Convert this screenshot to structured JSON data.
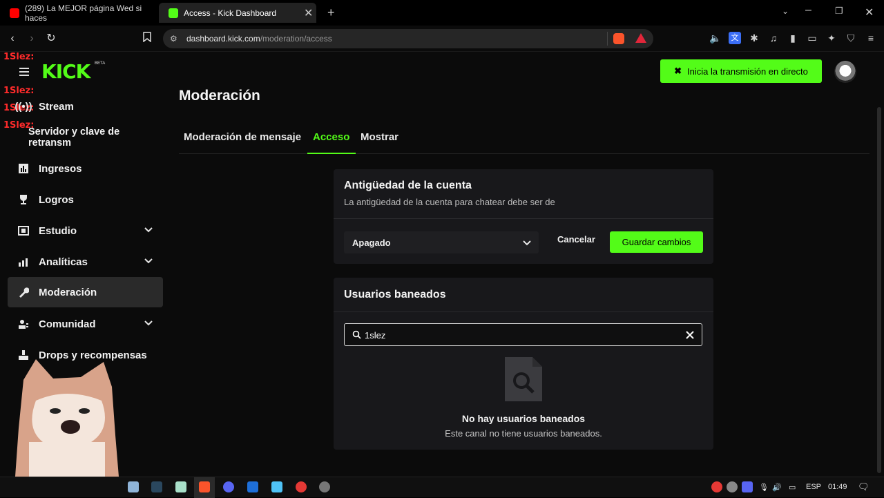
{
  "browser": {
    "tabs": [
      {
        "title": "(289) La MEJOR página Wed si haces",
        "favicon_color": "#ff0000"
      },
      {
        "title": "Access - Kick Dashboard",
        "favicon_color": "#53fc18"
      }
    ],
    "url_host": "dashboard.kick.com",
    "url_path": "/moderation/access"
  },
  "overlay": {
    "name": "1Slez:",
    "logo_text": "KICK",
    "logo_badge": "BETA"
  },
  "sidebar": {
    "items": [
      {
        "label": "Stream",
        "icon": "broadcast-icon"
      },
      {
        "label": "Servidor y clave de retransm",
        "icon": ""
      },
      {
        "label": "Ingresos",
        "icon": "bar-chart-icon"
      },
      {
        "label": "Logros",
        "icon": "trophy-icon"
      },
      {
        "label": "Estudio",
        "icon": "studio-icon"
      },
      {
        "label": "Analíticas",
        "icon": "analytics-icon"
      },
      {
        "label": "Moderación",
        "icon": "wrench-icon"
      },
      {
        "label": "Comunidad",
        "icon": "community-icon"
      },
      {
        "label": "Drops y recompensas",
        "icon": "drops-icon"
      }
    ]
  },
  "header": {
    "go_live_label": "Inicia la transmisión en directo"
  },
  "main": {
    "title": "Moderación",
    "tabs": [
      {
        "label": "Moderación de mensaje"
      },
      {
        "label": "Acceso"
      },
      {
        "label": "Mostrar"
      }
    ],
    "account_age": {
      "title": "Antigüedad de la cuenta",
      "subtitle": "La antigüedad de la cuenta para chatear debe ser de",
      "selected": "Apagado",
      "cancel_label": "Cancelar",
      "save_label": "Guardar cambios"
    },
    "banned": {
      "title": "Usuarios baneados",
      "search_value": "1slez",
      "empty_title": "No hay usuarios baneados",
      "empty_subtitle": "Este canal no tiene usuarios baneados."
    }
  },
  "taskbar": {
    "language": "ESP",
    "time": "01:49"
  },
  "colors": {
    "accent": "#53fc18",
    "background": "#0b0b0b",
    "card": "#18181b"
  }
}
